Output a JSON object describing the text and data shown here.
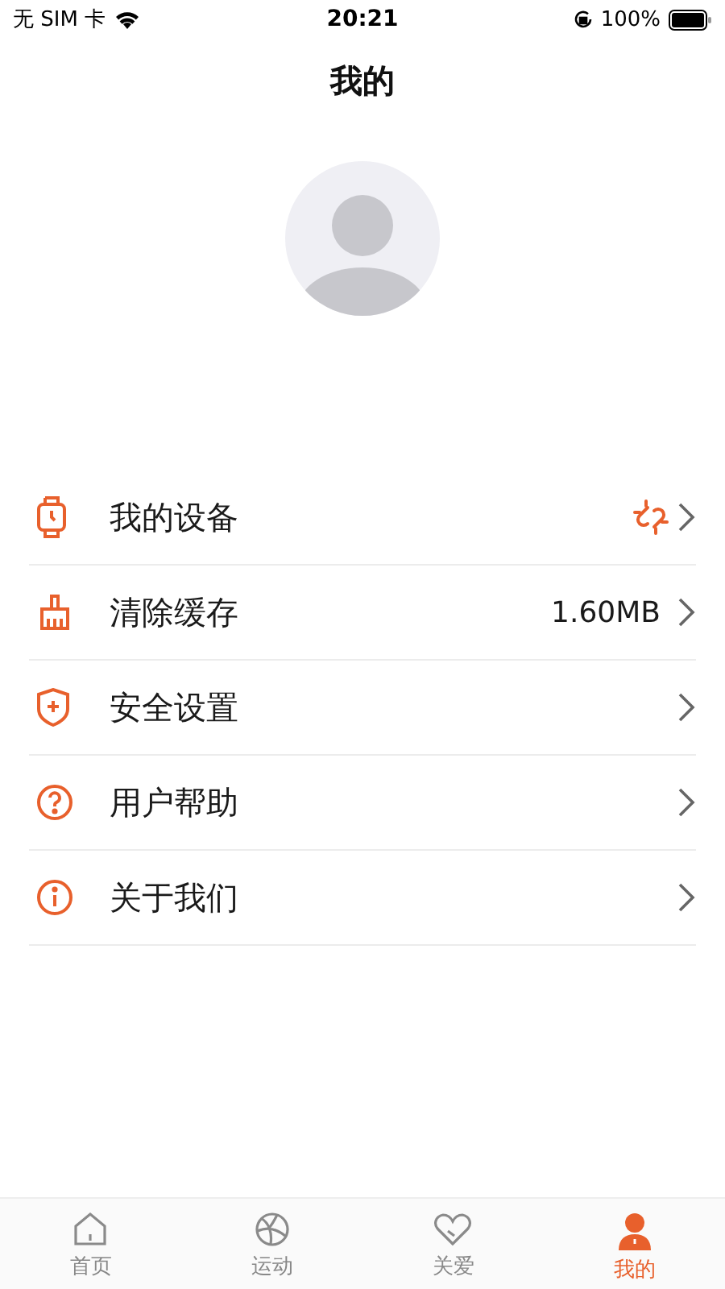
{
  "status_bar": {
    "carrier": "无 SIM 卡",
    "time": "20:21",
    "battery": "100%"
  },
  "title": "我的",
  "menu": [
    {
      "kind": "watch",
      "label": "我的设备",
      "unlinked": true
    },
    {
      "kind": "broom",
      "label": "清除缓存",
      "value": "1.60MB"
    },
    {
      "kind": "shield",
      "label": "安全设置"
    },
    {
      "kind": "help",
      "label": "用户帮助"
    },
    {
      "kind": "info",
      "label": "关于我们"
    }
  ],
  "tabs": [
    {
      "kind": "home",
      "label": "首页",
      "selected": false
    },
    {
      "kind": "ball",
      "label": "运动",
      "selected": false
    },
    {
      "kind": "heart",
      "label": "关爱",
      "selected": false
    },
    {
      "kind": "person",
      "label": "我的",
      "selected": true
    }
  ]
}
